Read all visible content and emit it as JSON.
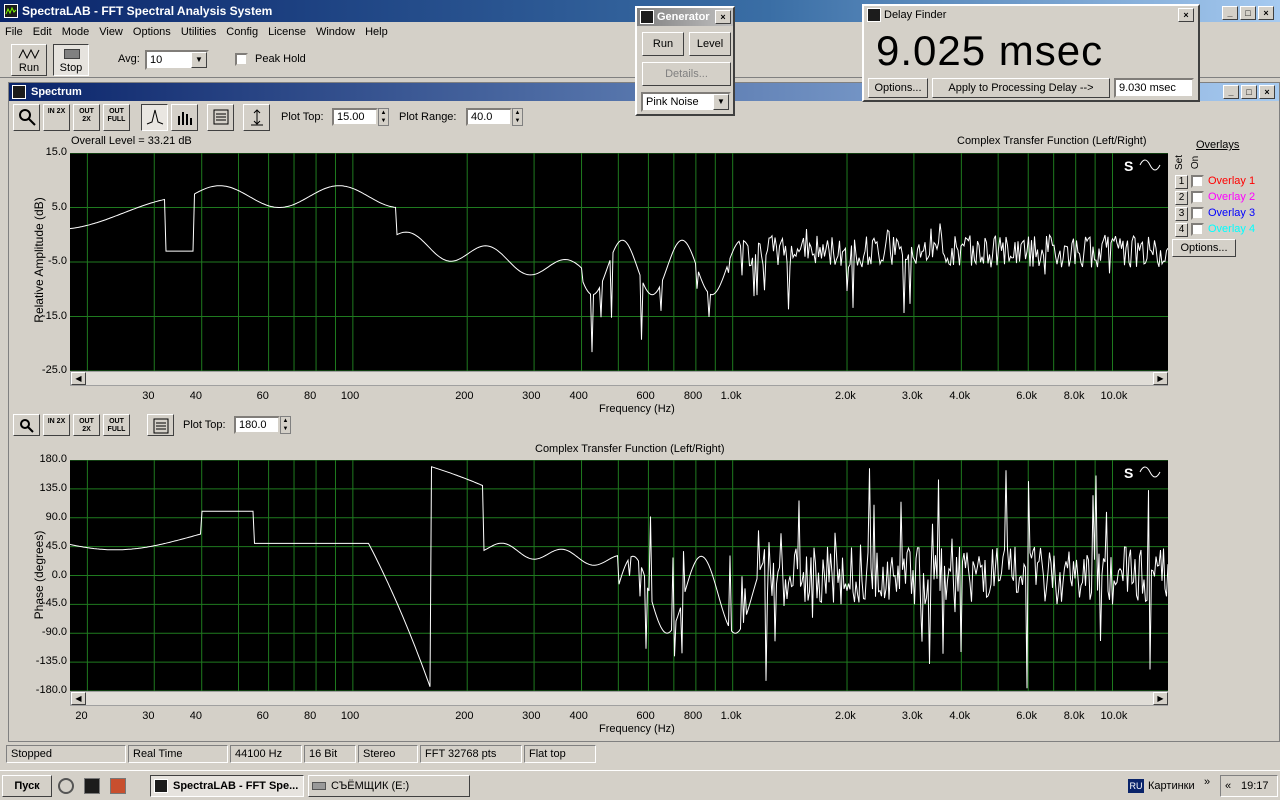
{
  "app": {
    "title": "SpectraLAB - FFT Spectral Analysis System"
  },
  "menu": [
    "File",
    "Edit",
    "Mode",
    "View",
    "Options",
    "Utilities",
    "Config",
    "License",
    "Window",
    "Help"
  ],
  "toolbar": {
    "run_label": "Run",
    "stop_label": "Stop",
    "avg_label": "Avg:",
    "avg_value": "10",
    "peak_hold_label": "Peak Hold"
  },
  "spectrum": {
    "window_title": "Spectrum",
    "plot_top_label": "Plot Top:",
    "plot_top_value": "15.00",
    "plot_range_label": "Plot Range:",
    "plot_range_value": "40.0",
    "overall_level": "Overall Level = 33.21 dB",
    "top_title": "Complex Transfer Function (Left/Right)",
    "top_ylabel": "Relative Amplitude (dB)",
    "top_yticks": [
      "15.0",
      "5.0",
      "-5.0",
      "-15.0",
      "-25.0"
    ],
    "top_xticks": [
      "30",
      "40",
      "60",
      "80",
      "100",
      "200",
      "300",
      "400",
      "600",
      "800",
      "1.0k",
      "2.0k",
      "3.0k",
      "4.0k",
      "6.0k",
      "8.0k",
      "10.0k"
    ],
    "xlabel": "Frequency (Hz)",
    "bottom_plot_top_value": "180.0",
    "bottom_title": "Complex Transfer Function (Left/Right)",
    "bottom_ylabel": "Phase (degrees)",
    "bottom_yticks": [
      "180.0",
      "135.0",
      "90.0",
      "45.0",
      "0.0",
      "-45.0",
      "-90.0",
      "-135.0",
      "-180.0"
    ],
    "bottom_xticks": [
      "20",
      "30",
      "40",
      "60",
      "80",
      "100",
      "200",
      "300",
      "400",
      "600",
      "800",
      "1.0k",
      "2.0k",
      "3.0k",
      "4.0k",
      "6.0k",
      "8.0k",
      "10.0k"
    ],
    "zoom_in": "IN 2X",
    "zoom_out": "OUT 2X",
    "zoom_full": "OUT FULL"
  },
  "overlays": {
    "title": "Overlays",
    "set_label": "Set",
    "on_label": "On",
    "items": [
      {
        "num": "1",
        "label": "Overlay 1",
        "color": "#ff0000"
      },
      {
        "num": "2",
        "label": "Overlay 2",
        "color": "#ff00ff"
      },
      {
        "num": "3",
        "label": "Overlay 3",
        "color": "#0000ff"
      },
      {
        "num": "4",
        "label": "Overlay 4",
        "color": "#00ffff"
      }
    ],
    "options_label": "Options..."
  },
  "generator": {
    "title": "Generator",
    "run_label": "Run",
    "level_label": "Level",
    "details_label": "Details...",
    "signal": "Pink Noise"
  },
  "delay_finder": {
    "title": "Delay Finder",
    "value": "9.025 msec",
    "options_label": "Options...",
    "apply_label": "Apply to Processing Delay -->",
    "delay_value": "9.030 msec"
  },
  "status": [
    "Stopped",
    "Real Time",
    "44100 Hz",
    "16 Bit",
    "Stereo",
    "FFT 32768 pts",
    "Flat top"
  ],
  "taskbar": {
    "start": "Пуск",
    "tasks": [
      "SpectraLAB - FFT Spe...",
      "СЪЁМЩИК (E:)"
    ],
    "lang": "RU",
    "tray_label": "Картинки",
    "clock": "19:17"
  },
  "colors": {
    "trace": "#ffffff",
    "grid": "#1f7a1f",
    "plot_bg": "#000000"
  }
}
